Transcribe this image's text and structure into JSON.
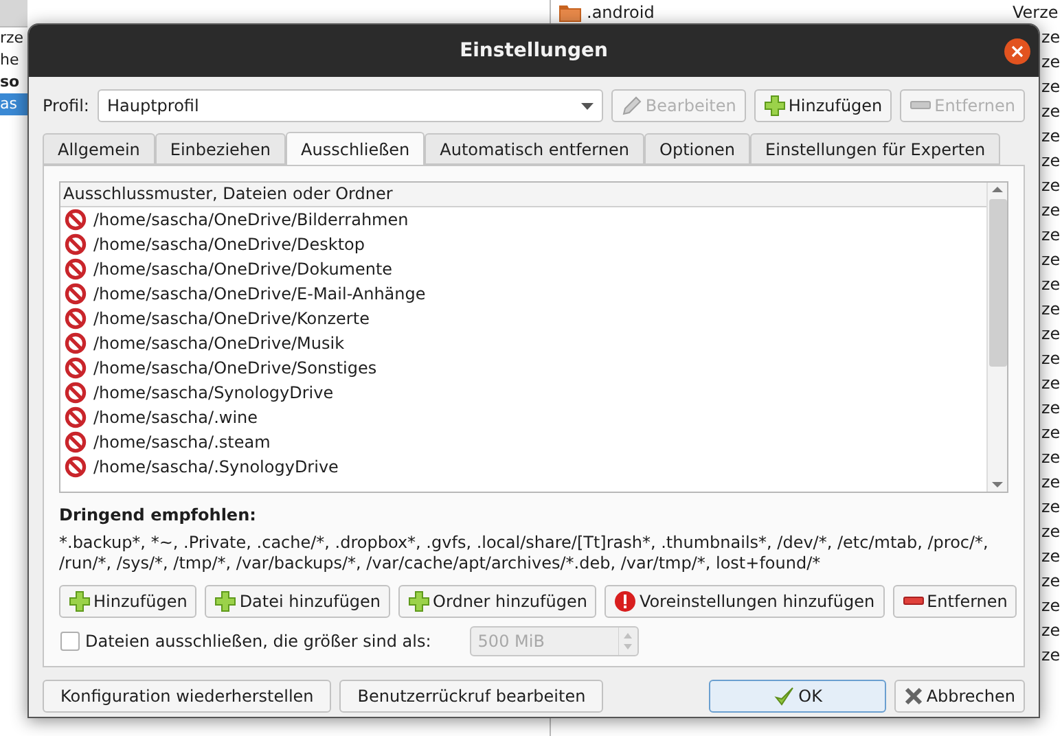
{
  "background": {
    "left_rows": [
      {
        "text": "rze",
        "kind": "normal"
      },
      {
        "text": "he",
        "kind": "normal"
      },
      {
        "text": "so",
        "kind": "bold"
      },
      {
        "text": "as",
        "kind": "selected"
      }
    ],
    "top_row": {
      "name": ".android",
      "type": "Verze"
    },
    "right_rows": [
      "ze",
      "ze",
      "ze",
      "ze",
      "ze",
      "ze",
      "ze",
      "ze",
      "ze",
      "ze",
      "ze",
      "ze",
      "ze",
      "ze",
      "ze",
      "ze",
      "ze",
      "ze",
      "ze",
      "ze",
      "ze",
      "ze",
      "ze",
      "ze",
      "ze",
      "ze"
    ]
  },
  "window": {
    "title": "Einstellungen"
  },
  "profile": {
    "label": "Profil:",
    "value": "Hauptprofil",
    "buttons": [
      {
        "label": "Bearbeiten",
        "kind": "edit",
        "disabled": true
      },
      {
        "label": "Hinzufügen",
        "kind": "add",
        "disabled": false
      },
      {
        "label": "Entfernen",
        "kind": "remove",
        "disabled": true
      }
    ]
  },
  "tabs": [
    {
      "label": "Allgemein",
      "selected": false
    },
    {
      "label": "Einbeziehen",
      "selected": false
    },
    {
      "label": "Ausschließen",
      "selected": true
    },
    {
      "label": "Automatisch entfernen",
      "selected": false
    },
    {
      "label": "Optionen",
      "selected": false
    },
    {
      "label": "Einstellungen für Experten",
      "selected": false
    }
  ],
  "exclude_list": {
    "header": "Ausschlussmuster, Dateien oder Ordner",
    "rows": [
      "/home/sascha/OneDrive/Bilderrahmen",
      "/home/sascha/OneDrive/Desktop",
      "/home/sascha/OneDrive/Dokumente",
      "/home/sascha/OneDrive/E-Mail-Anhänge",
      "/home/sascha/OneDrive/Konzerte",
      "/home/sascha/OneDrive/Musik",
      "/home/sascha/OneDrive/Sonstiges",
      "/home/sascha/SynologyDrive",
      "/home/sascha/.wine",
      "/home/sascha/.steam",
      "/home/sascha/.SynologyDrive"
    ]
  },
  "recommended": {
    "heading": "Dringend empfohlen:",
    "text": "*.backup*, *~, .Private, .cache/*, .dropbox*, .gvfs, .local/share/[Tt]rash*, .thumbnails*, /dev/*, /etc/mtab, /proc/*, /run/*, /sys/*, /tmp/*, /var/backups/*, /var/cache/apt/archives/*.deb, /var/tmp/*, lost+found/*"
  },
  "list_buttons": [
    {
      "label": "Hinzufügen",
      "kind": "add"
    },
    {
      "label": "Datei hinzufügen",
      "kind": "add"
    },
    {
      "label": "Ordner hinzufügen",
      "kind": "add"
    },
    {
      "label": "Voreinstellungen hinzufügen",
      "kind": "defaults"
    },
    {
      "label": "Entfernen",
      "kind": "remove"
    }
  ],
  "size_limit": {
    "label": "Dateien ausschließen, die größer sind als:",
    "checked": false,
    "value": "500 MiB",
    "disabled": true
  },
  "footer": {
    "left_buttons": [
      "Konfiguration wiederherstellen",
      "Benutzerrückruf bearbeiten"
    ],
    "ok": "OK",
    "cancel": "Abbrechen"
  }
}
